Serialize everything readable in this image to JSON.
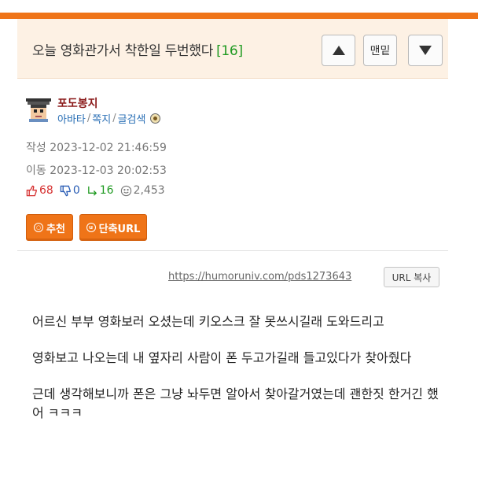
{
  "post": {
    "title": "오늘 영화관가서 착한일 두번했다",
    "comment_count": "[16]"
  },
  "nav": {
    "up_icon": "triangle-up-icon",
    "bottom_label": "맨밑",
    "down_icon": "triangle-down-icon"
  },
  "author": {
    "name": "포도봉지",
    "link_avatar": "아바타",
    "link_message": "쪽지",
    "link_posts": "글검색",
    "sep": "/"
  },
  "meta": {
    "created": "작성 2023-12-02 21:46:59",
    "updated": "이동 2023-12-03 20:02:53"
  },
  "stats": {
    "upvotes": "68",
    "downvotes": "0",
    "replies": "16",
    "views": "2,453",
    "colors": {
      "up": "#d63030",
      "down": "#2a5db5",
      "reply": "#1f9a21",
      "views": "#777777"
    }
  },
  "actions": {
    "recommend_label": "추천",
    "shorturl_label": "단축URL",
    "accent": "#ef7418"
  },
  "url": {
    "link": "https://humoruniv.com/pds1273643",
    "copy_label": "URL 복사"
  },
  "content": {
    "paragraphs": [
      "어르신 부부 영화보러 오셨는데 키오스크 잘 못쓰시길래 도와드리고",
      "영화보고 나오는데 내 옆자리 사람이 폰 두고가길래 들고있다가 찾아줬다",
      "근데 생각해보니까 폰은 그냥 놔두면 알아서 찾아갈거였는데 괜한짓 한거긴 했어 ㅋㅋㅋ"
    ]
  }
}
